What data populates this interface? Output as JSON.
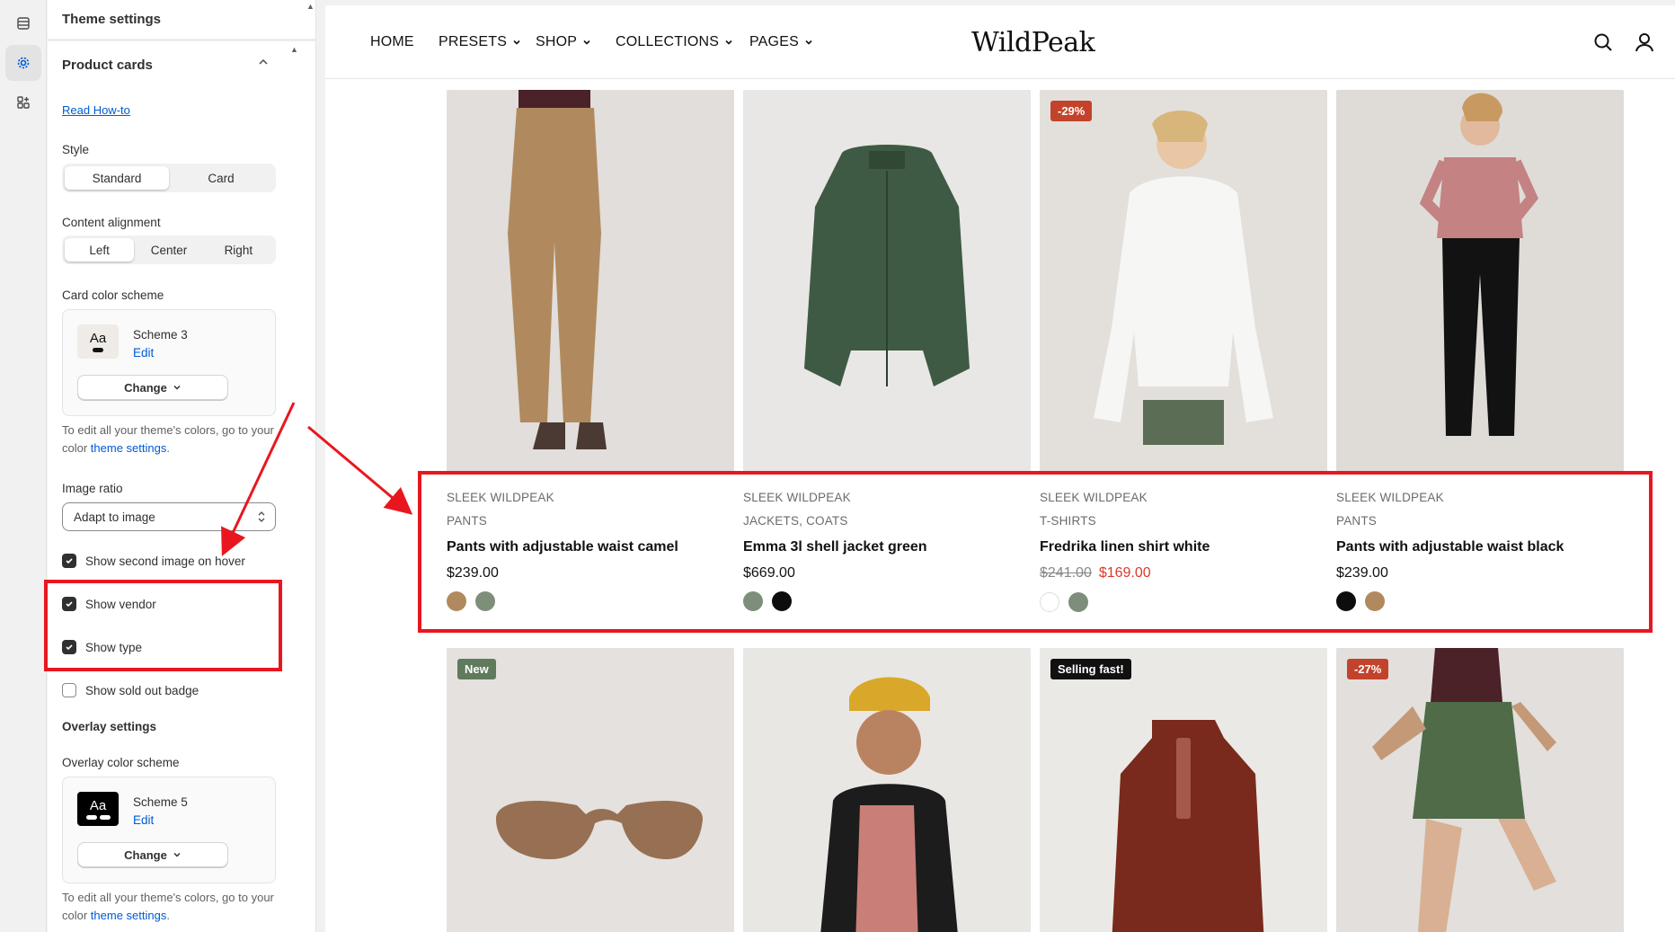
{
  "panel": {
    "title": "Theme settings",
    "section_title": "Product cards",
    "how_to_link": "Read How-to",
    "style": {
      "label": "Style",
      "options": [
        "Standard",
        "Card"
      ],
      "selected": "Standard"
    },
    "alignment": {
      "label": "Content alignment",
      "options": [
        "Left",
        "Center",
        "Right"
      ],
      "selected": "Left"
    },
    "card_scheme": {
      "label": "Card color scheme",
      "name": "Scheme 3",
      "edit": "Edit",
      "change": "Change",
      "swatch_text": "Aa",
      "swatch_bg": "#efece7"
    },
    "help_text_1": "To edit all your theme's colors, go to your color ",
    "help_link_1": "theme settings",
    "help_end": ".",
    "image_ratio": {
      "label": "Image ratio",
      "value": "Adapt to image"
    },
    "checks": {
      "second_image": {
        "label": "Show second image on hover",
        "checked": true
      },
      "vendor": {
        "label": "Show vendor",
        "checked": true
      },
      "type": {
        "label": "Show type",
        "checked": true
      },
      "sold_out": {
        "label": "Show sold out badge",
        "checked": false
      }
    },
    "overlay_title": "Overlay settings",
    "overlay_scheme": {
      "label": "Overlay color scheme",
      "name": "Scheme 5",
      "edit": "Edit",
      "change": "Change",
      "swatch_text": "Aa",
      "swatch_bg": "#000000"
    },
    "help_text_2": "To edit all your theme's colors, go to your color ",
    "help_link_2": "theme settings"
  },
  "nav": {
    "items": [
      "HOME",
      "PRESETS",
      "SHOP",
      "COLLECTIONS",
      "PAGES"
    ],
    "logo": "WildPeak"
  },
  "products_row1": [
    {
      "badge": "",
      "vendor": "SLEEK WILDPEAK",
      "type": "PANTS",
      "title": "Pants with adjustable waist camel",
      "price": "$239.00",
      "old_price": "",
      "swatches": [
        "#b08a5e",
        "#7d8f7a"
      ],
      "image": "camel-pants"
    },
    {
      "badge": "",
      "vendor": "SLEEK WILDPEAK",
      "type": "JACKETS, COATS",
      "title": "Emma 3l shell jacket green",
      "price": "$669.00",
      "old_price": "",
      "swatches": [
        "#7d8f7a",
        "#0d0d0d"
      ],
      "image": "green-jacket"
    },
    {
      "badge": "-29%",
      "vendor": "SLEEK WILDPEAK",
      "type": "T-SHIRTS",
      "title": "Fredrika linen shirt white",
      "price": "$169.00",
      "old_price": "$241.00",
      "swatches": [
        "#ffffff",
        "#7d8f7a"
      ],
      "image": "white-shirt"
    },
    {
      "badge": "",
      "vendor": "SLEEK WILDPEAK",
      "type": "PANTS",
      "title": "Pants with adjustable waist black",
      "price": "$239.00",
      "old_price": "",
      "swatches": [
        "#0d0d0d",
        "#b08a5e"
      ],
      "image": "black-pants"
    }
  ],
  "products_row2_badges": [
    "New",
    "",
    "Selling fast!",
    "-27%"
  ],
  "colors": {
    "accent": "#e8171f",
    "link": "#005bd3",
    "sale": "#d93a2b",
    "badge_sale": "#c2432b",
    "badge_new": "#5f7a5c",
    "badge_dark": "#111111"
  }
}
